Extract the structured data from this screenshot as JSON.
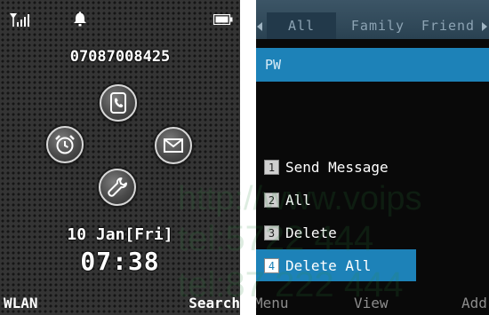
{
  "standby": {
    "phone_number": "07087008425",
    "date": "10 Jan[Fri]",
    "time": "07:38",
    "shortcuts": [
      {
        "icon": "phonebook-icon"
      },
      {
        "icon": "alarm-clock-icon"
      },
      {
        "icon": "envelope-icon"
      },
      {
        "icon": "wrench-settings-icon"
      }
    ],
    "softkeys": {
      "left": "WLAN",
      "right": "Search"
    },
    "status": {
      "signal": "signal-bars-icon",
      "profile": "bell-icon",
      "battery": "battery-icon"
    }
  },
  "phonebook": {
    "tabs": [
      "All",
      "Family",
      "Friend"
    ],
    "selected_tab": "All",
    "contact": "PW",
    "options_menu": [
      {
        "num": "1",
        "label": "Send Message"
      },
      {
        "num": "2",
        "label": "All"
      },
      {
        "num": "3",
        "label": "Delete"
      },
      {
        "num": "4",
        "label": "Delete All"
      }
    ],
    "selected_option": "Delete All",
    "softkeys": {
      "left": "Menu",
      "center": "View",
      "right": "Add"
    }
  },
  "watermark": {
    "line1": "http://www.voips",
    "line2": "tel:5722 444",
    "line3": "tel:87 222 444"
  },
  "colors": {
    "accent": "#1d82b8",
    "tab_bar": "#2f4a5b",
    "standby_bg": "#343434"
  }
}
